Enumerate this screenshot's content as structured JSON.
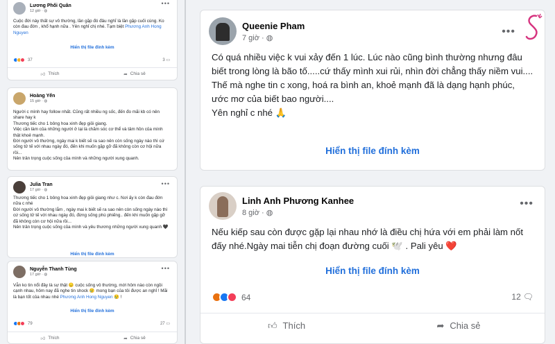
{
  "left_posts": [
    {
      "name": "Lương Phối Quân",
      "meta": "12 giờ · ",
      "text": "Cuộc đời này thất sự vô thường, lần gặp đó đâu nghĩ là lần gặp cuối cùng. Ko còn đau đớn , khổ hạnh nữa . Yên nghỉ chị nhé. Tạm biệt ",
      "mention": "Phương Anh Hong Nguyen",
      "attach": "Hiển thị file đính kèm",
      "reactions": "37",
      "comments": "3",
      "like": "Thích",
      "share": "Chia sẻ"
    },
    {
      "name": "Hoàng Yến",
      "meta": "15 giờ · ",
      "lines": [
        "Người c mình hay follow nhất. Cũng rất nhiều ng sốc, đến đo mãi kb có nên share hay k",
        "Thương tiếc cho 1 bông hoa xinh đẹp giỏi giang.",
        "Việc cần làm của những người ở lại là chăm sóc cơ thể và tâm hồn của mình thật khoẻ mạnh.",
        "Đời người vô thường, ngày mai k biết sẽ ra sao nên còn sống ngày nào thì cứ sống tử tế với nhau ngày đó, đến khi muốn gặp gỡ đã không còn cơ hội nữa rồi...",
        "Nên trân trọng cuộc sống của mình và những người xung quanh."
      ]
    },
    {
      "name": "Julia Tran",
      "meta": "17 giờ · ",
      "lines": [
        "Thương tiếc cho 1 bông hoa xinh đẹp giỏi giang như c. Nơi ấy k còn đau đớn nữa c nhé",
        "Đời người vô thường lắm , ngày mai k biết sẽ ra sao nên còn sống ngày nào thì cứ sống tử tế với nhau ngày đó, đừng sống phù phiếng.. đến khi muốn gặp gỡ đã không còn cơ hội nữa rồi...",
        "Nên trân trọng cuộc sống của mình và yêu thương những người xung quanh 🖤"
      ],
      "attach": "Hiển thị file đính kèm"
    },
    {
      "name": "Nguyễn Thanh Tùng",
      "meta": "17 giờ · ",
      "text": "Vẫn ko tin nổi đây là sự thật 😔 cuộc sống vô thường, mới hôm nào còn ngồi cạnh nhau, hôm nay đã nghe tin shock 😢 mong bạn của tôi được an nghỉ ! Mãi là bạn tốt của nhau nhé ",
      "mention": "Phương Anh Hong Nguyen",
      "suffix": " 😢 !",
      "attach": "Hiển thị file đính kèm",
      "reactions": "79",
      "comments": "27",
      "like": "Thích",
      "share": "Chia sẻ"
    }
  ],
  "right_posts": [
    {
      "name": "Queenie Pham",
      "meta": "7 giờ · ",
      "lines": [
        "Có quá nhiều việc k vui xảy đến 1 lúc. Lúc nào cũng bình thường nhưng đâu biết trong lòng là bão tố.....cứ thấy mình xui rủi, nhìn đời chẳng thấy niềm vui....",
        "Thế mà nghe tin c xong, hoá ra bình an, khoẻ mạnh đã là dạng hạnh phúc, ước mơ của biết bao người....",
        "Yên nghỉ c nhé 🙏"
      ],
      "attach": "Hiển thị file đính kèm"
    },
    {
      "name": "Linh Anh Phương Kanhee",
      "meta": "8 giờ · ",
      "text": "Nếu kiếp sau còn được gặp lại nhau nhớ là điều chị hứa với em phải làm nốt đấy nhé.Ngày mai tiễn chị đoạn đường cuối 🕊️ . Pali yêu ❤️",
      "attach": "Hiển thị file đính kèm",
      "reactions": "64",
      "comments": "12",
      "like": "Thích",
      "share": "Chia sẻ"
    }
  ],
  "icons": {
    "globe": "globe-icon",
    "more": "more-options-icon",
    "like": "like-icon",
    "share": "share-icon",
    "comment": "comment-icon"
  },
  "colors": {
    "link": "#216fdb",
    "brand_logo": "#d6337f"
  },
  "ui": {
    "more": "•••",
    "globe": "🌐"
  }
}
